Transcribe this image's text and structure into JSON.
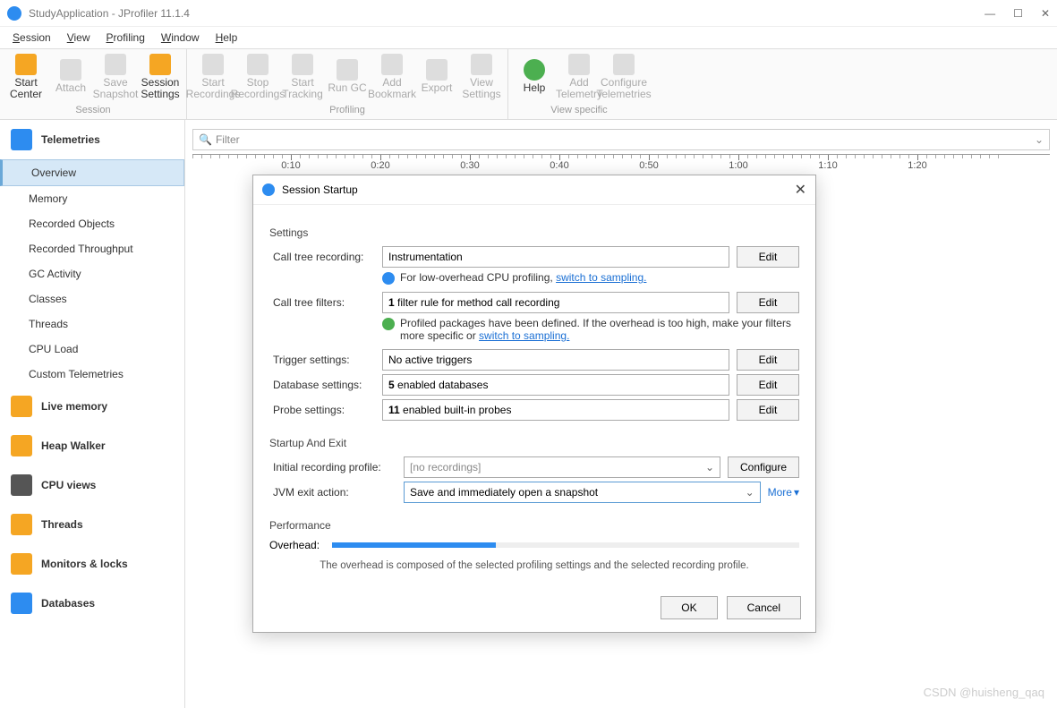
{
  "titlebar": {
    "title": "StudyApplication - JProfiler 11.1.4"
  },
  "menubar": [
    "Session",
    "View",
    "Profiling",
    "Window",
    "Help"
  ],
  "toolbar": {
    "groups": [
      {
        "label": "Session",
        "buttons": [
          "Start\nCenter",
          "Attach",
          "Save\nSnapshot",
          "Session\nSettings"
        ]
      },
      {
        "label": "Profiling",
        "buttons": [
          "Start\nRecordings",
          "Stop\nRecordings",
          "Start\nTracking",
          "Run GC",
          "Add\nBookmark",
          "Export",
          "View\nSettings"
        ]
      },
      {
        "label": "View specific",
        "buttons": [
          "Help",
          "Add\nTelemetry",
          "Configure\nTelemetries"
        ]
      }
    ]
  },
  "filter": {
    "placeholder": "Filter"
  },
  "timeline": {
    "labels": [
      "0:10",
      "0:20",
      "0:30",
      "0:40",
      "0:50",
      "1:00",
      "1:10",
      "1:20"
    ]
  },
  "sidebar": {
    "sections": [
      {
        "title": "Telemetries",
        "items": [
          "Overview",
          "Memory",
          "Recorded Objects",
          "Recorded Throughput",
          "GC Activity",
          "Classes",
          "Threads",
          "CPU Load",
          "Custom Telemetries"
        ]
      },
      {
        "title": "Live memory",
        "items": []
      },
      {
        "title": "Heap Walker",
        "items": []
      },
      {
        "title": "CPU views",
        "items": []
      },
      {
        "title": "Threads",
        "items": []
      },
      {
        "title": "Monitors & locks",
        "items": []
      },
      {
        "title": "Databases",
        "items": []
      }
    ]
  },
  "dialog": {
    "title": "Session Startup",
    "settings_label": "Settings",
    "rows": {
      "call_tree_recording": {
        "label": "Call tree recording:",
        "value": "Instrumentation",
        "edit": "Edit"
      },
      "call_tree_hint": {
        "text": "For low-overhead CPU profiling, ",
        "link": "switch to sampling."
      },
      "call_tree_filters": {
        "label": "Call tree filters:",
        "value": "1 filter rule for method call recording",
        "edit": "Edit"
      },
      "filters_hint": {
        "text": "Profiled packages have been defined. If the overhead is too high, make your filters more specific or ",
        "link": "switch to sampling."
      },
      "trigger": {
        "label": "Trigger settings:",
        "value": "No active triggers",
        "edit": "Edit"
      },
      "database": {
        "label": "Database settings:",
        "value": "5 enabled databases",
        "edit": "Edit"
      },
      "probe": {
        "label": "Probe settings:",
        "value": "11 enabled built-in probes",
        "edit": "Edit"
      }
    },
    "startup_label": "Startup And Exit",
    "initial_profile": {
      "label": "Initial recording profile:",
      "value": "[no recordings]",
      "button": "Configure"
    },
    "jvm_exit": {
      "label": "JVM exit action:",
      "value": "Save and immediately open a snapshot",
      "more": "More"
    },
    "performance_label": "Performance",
    "overhead_label": "Overhead:",
    "perf_desc": "The overhead is composed of the selected profiling settings and the selected recording profile.",
    "ok": "OK",
    "cancel": "Cancel"
  },
  "watermark": "CSDN @huisheng_qaq"
}
